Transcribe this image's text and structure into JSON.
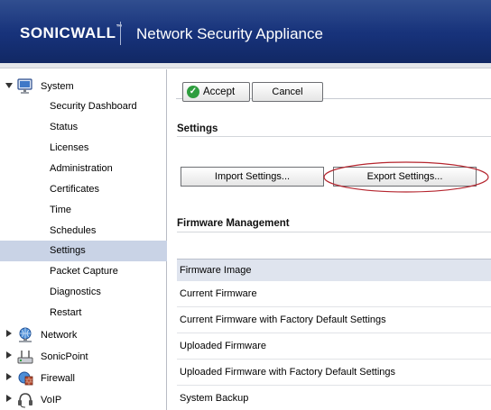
{
  "header": {
    "logo_text": "SONICWALL",
    "logo_mark": "™",
    "title": "Network Security Appliance"
  },
  "colors": {
    "header_bg": "#17327a",
    "active_nav_bg": "#c9d3e6",
    "accept_icon": "#2e9d3e",
    "highlight_ellipse": "#b5252e"
  },
  "sidebar": {
    "system": {
      "label": "System",
      "icon": "monitor-icon",
      "expanded": true,
      "items": [
        {
          "label": "Security Dashboard"
        },
        {
          "label": "Status"
        },
        {
          "label": "Licenses"
        },
        {
          "label": "Administration"
        },
        {
          "label": "Certificates"
        },
        {
          "label": "Time"
        },
        {
          "label": "Schedules"
        },
        {
          "label": "Settings",
          "active": true
        },
        {
          "label": "Packet Capture"
        },
        {
          "label": "Diagnostics"
        },
        {
          "label": "Restart"
        }
      ]
    },
    "sections": [
      {
        "label": "Network",
        "icon": "network-globe-icon"
      },
      {
        "label": "SonicPoint",
        "icon": "access-point-icon"
      },
      {
        "label": "Firewall",
        "icon": "firewall-icon"
      },
      {
        "label": "VoIP",
        "icon": "headset-icon"
      }
    ]
  },
  "toolbar": {
    "accept_label": "Accept",
    "cancel_label": "Cancel"
  },
  "settings": {
    "title": "Settings",
    "import_label": "Import Settings...",
    "export_label": "Export Settings..."
  },
  "firmware": {
    "title": "Firmware Management",
    "header_label": "Firmware Image",
    "rows": [
      {
        "label": "Current Firmware"
      },
      {
        "label": "Current Firmware with Factory Default Settings"
      },
      {
        "label": "Uploaded Firmware"
      },
      {
        "label": "Uploaded Firmware with Factory Default Settings"
      },
      {
        "label": "System Backup"
      }
    ]
  }
}
